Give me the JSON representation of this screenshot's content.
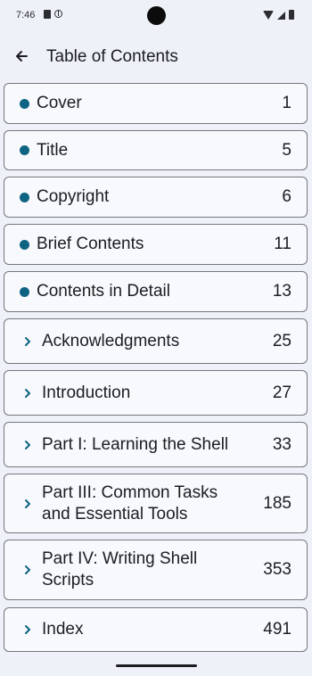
{
  "status_bar": {
    "time": "7:46",
    "left_icons": [
      "sim-card-icon",
      "globe-icon"
    ],
    "right_icons": [
      "wifi-icon",
      "signal-icon",
      "battery-icon"
    ]
  },
  "app_bar": {
    "title": "Table of Contents",
    "back_icon": "arrow-back-icon"
  },
  "accent_color": "#0e6383",
  "toc": [
    {
      "marker": "dot",
      "label": "Cover",
      "page": "1"
    },
    {
      "marker": "dot",
      "label": "Title",
      "page": "5"
    },
    {
      "marker": "dot",
      "label": "Copyright",
      "page": "6"
    },
    {
      "marker": "dot",
      "label": "Brief Contents",
      "page": "11"
    },
    {
      "marker": "dot",
      "label": "Contents in Detail",
      "page": "13"
    },
    {
      "marker": "chevron",
      "label": "Acknowledgments",
      "page": "25"
    },
    {
      "marker": "chevron",
      "label": "Introduction",
      "page": "27"
    },
    {
      "marker": "chevron",
      "label": "Part I: Learning the Shell",
      "page": "33"
    },
    {
      "marker": "chevron",
      "label": "Part III: Common Tasks and Essential Tools",
      "page": "185"
    },
    {
      "marker": "chevron",
      "label": "Part IV: Writing Shell Scripts",
      "page": "353"
    },
    {
      "marker": "chevron",
      "label": "Index",
      "page": "491"
    }
  ]
}
